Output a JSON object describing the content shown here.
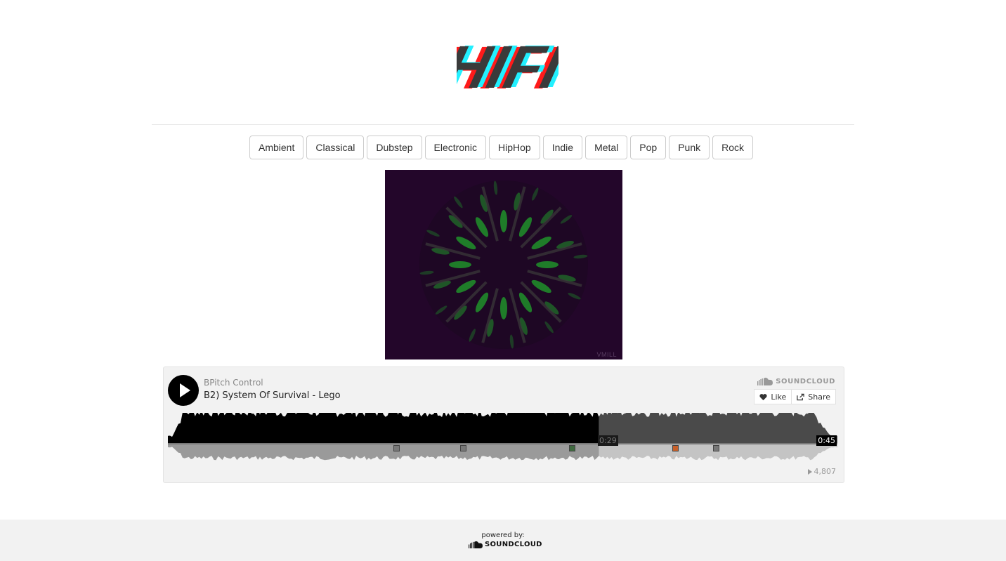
{
  "logo": {
    "text": "HIFI",
    "colors": {
      "main": "#3a3a3a",
      "red": "#ff1a1a",
      "cyan": "#22f0ff"
    }
  },
  "genres": [
    "Ambient",
    "Classical",
    "Dubstep",
    "Electronic",
    "HipHop",
    "Indie",
    "Metal",
    "Pop",
    "Punk",
    "Rock"
  ],
  "visualizer": {
    "watermark": "VMILL",
    "background": "#23062a",
    "accent": "#1f8a2a"
  },
  "player": {
    "artist": "BPitch Control",
    "title": "B2) System Of Survival - Lego",
    "brand": "SOUNDCLOUD",
    "like_label": "Like",
    "share_label": "Share",
    "current_time": "0:29",
    "total_time": "0:45",
    "progress": 0.644,
    "play_count": "4,807",
    "icons": {
      "play": "play-icon",
      "cloud": "soundcloud-icon",
      "like": "heart-icon",
      "share": "share-icon",
      "plays": "play-count-icon"
    }
  },
  "footer": {
    "powered_by": "powered by:",
    "brand": "SOUNDCLOUD"
  }
}
